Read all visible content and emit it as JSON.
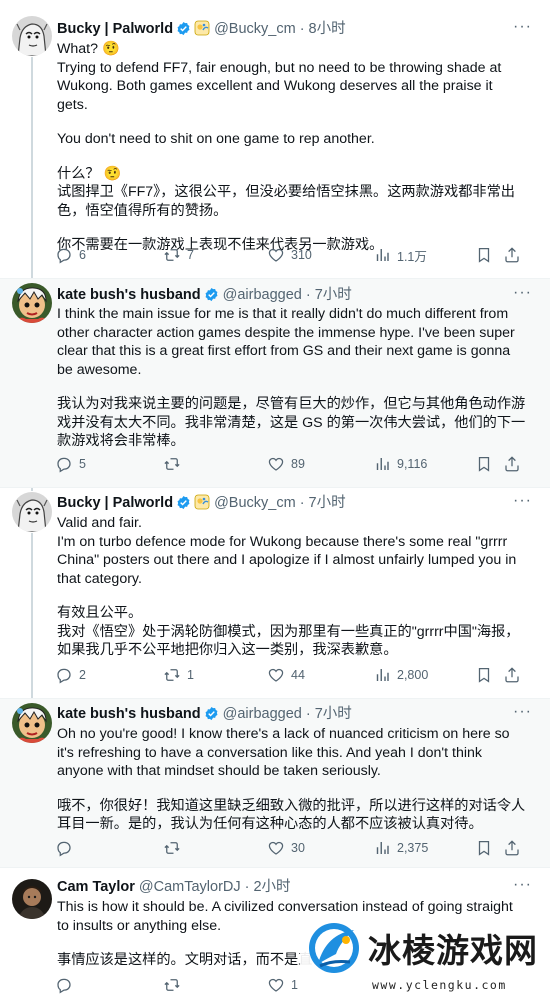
{
  "tweets": [
    {
      "name": "Bucky | Palworld",
      "handle": "@Bucky_cm",
      "time": "· 8小时",
      "lines": [
        "What? 🤨",
        "Trying to defend FF7, fair enough, but no need to be throwing shade at Wukong. Both games excellent and Wukong deserves all the praise it gets.",
        "You don't need to shit on one game to rep another.",
        "什么？ 🤨",
        "试图捍卫《FF7》，这很公平，但没必要给悟空抹黑。这两款游戏都非常出色，悟空值得所有的赞扬。",
        "你不需要在一款游戏上表现不佳来代表另一款游戏。"
      ],
      "stats": {
        "replies": "6",
        "retweets": "7",
        "likes": "310",
        "views": "1.1万"
      }
    },
    {
      "name": "kate bush's husband",
      "handle": "@airbagged",
      "time": "· 7小时",
      "lines": [
        "I think the main issue for me is that it really didn't do much different from other character action games despite the immense hype.  I've been super clear that this is a great first effort from GS and their next game is gonna be awesome.",
        "我认为对我来说主要的问题是，尽管有巨大的炒作，但它与其他角色动作游戏并没有太大不同。我非常清楚，这是 GS 的第一次伟大尝试，他们的下一款游戏将会非常棒。"
      ],
      "stats": {
        "replies": "5",
        "retweets": "",
        "likes": "89",
        "views": "9,116"
      }
    },
    {
      "name": "Bucky | Palworld",
      "handle": "@Bucky_cm",
      "time": "· 7小时",
      "lines": [
        "Valid and fair.",
        "I'm on turbo defence mode for Wukong because there's some real \"grrrr China\" posters out there and I apologize if I almost unfairly lumped you in that category.",
        "有效且公平。",
        "我对《悟空》处于涡轮防御模式，因为那里有一些真正的\"grrrr中国\"海报，如果我几乎不公平地把你归入这一类别，我深表歉意。"
      ],
      "stats": {
        "replies": "2",
        "retweets": "1",
        "likes": "44",
        "views": "2,800"
      }
    },
    {
      "name": "kate bush's husband",
      "handle": "@airbagged",
      "time": "· 7小时",
      "lines": [
        "Oh no you're good! I know there's a lack of nuanced criticism on here so it's refreshing to have a conversation like this.  And yeah I don't think anyone with that mindset should be taken seriously.",
        "哦不，你很好！我知道这里缺乏细致入微的批评，所以进行这样的对话令人耳目一新。是的，我认为任何有这种心态的人都不应该被认真对待。"
      ],
      "stats": {
        "replies": "",
        "retweets": "",
        "likes": "30",
        "views": "2,375"
      }
    },
    {
      "name": "Cam Taylor",
      "handle": "@CamTaylorDJ",
      "time": "· 2小时",
      "lines": [
        "This is how it should be. A civilized conversation instead of going straight to insults or anything else.",
        "事情应该是这样的。文明对话，而不是直"
      ],
      "stats": {
        "replies": "",
        "retweets": "",
        "likes": "1",
        "views": ""
      }
    }
  ],
  "watermark": {
    "title": "冰棱游戏网",
    "url": "www.yclengku.com"
  },
  "colors": {
    "verified": "#1d9bf0",
    "muted": "#536471",
    "text": "#0f1419",
    "shaded_bg": "#f7f9f9"
  }
}
